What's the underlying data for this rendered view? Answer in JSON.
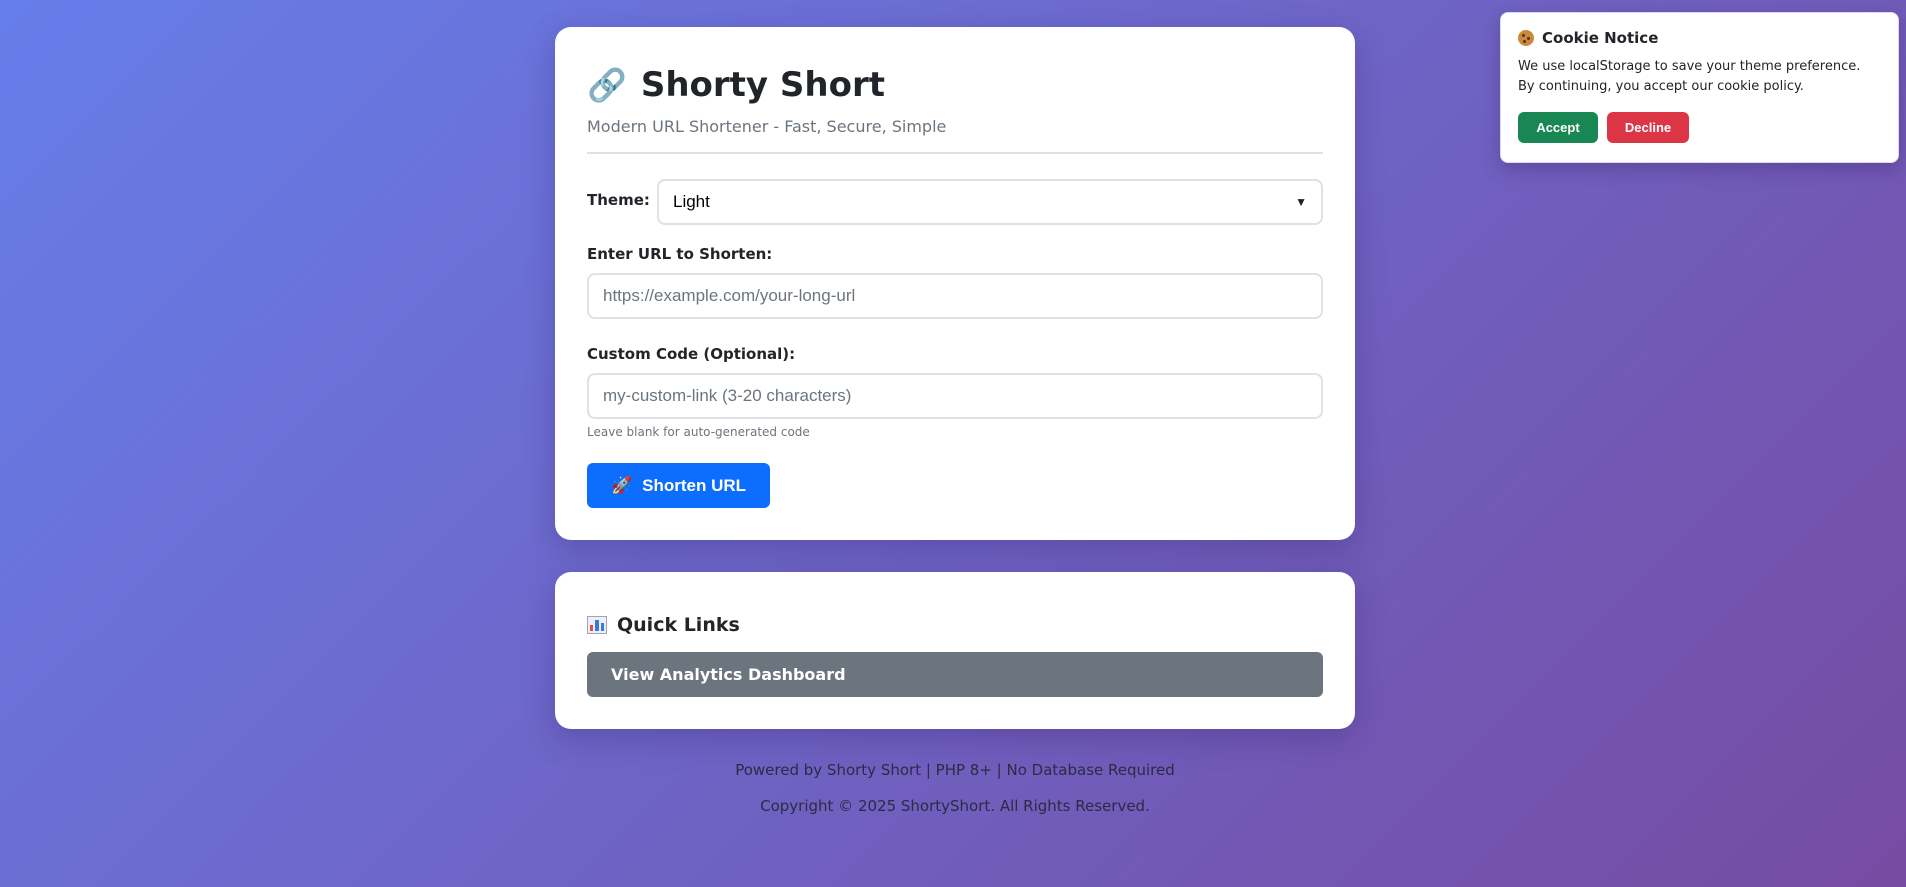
{
  "header": {
    "title": "Shorty Short",
    "subtitle": "Modern URL Shortener - Fast, Secure, Simple"
  },
  "form": {
    "theme_label": "Theme:",
    "theme_value": "Light",
    "url_label": "Enter URL to Shorten:",
    "url_placeholder": "https://example.com/your-long-url",
    "custom_label": "Custom Code (Optional):",
    "custom_placeholder": "my-custom-link (3-20 characters)",
    "custom_hint": "Leave blank for auto-generated code",
    "submit_label": "Shorten URL"
  },
  "quick_links": {
    "title": "Quick Links",
    "analytics_label": "View Analytics Dashboard"
  },
  "footer": {
    "powered": "Powered by Shorty Short | PHP 8+ | No Database Required",
    "copyright": "Copyright © 2025 ShortyShort. All Rights Reserved."
  },
  "cookie": {
    "title": "Cookie Notice",
    "text": "We use localStorage to save your theme preference. By continuing, you accept our cookie policy.",
    "accept_label": "Accept",
    "decline_label": "Decline"
  },
  "colors": {
    "primary": "#0d6efd",
    "secondary": "#6c757d",
    "accept": "#198754",
    "decline": "#dc3545"
  },
  "icons": {
    "title_icon": "link-icon",
    "submit_icon": "rocket-icon",
    "quick_links_icon": "bar-chart-icon",
    "cookie_icon": "cookie-icon"
  }
}
